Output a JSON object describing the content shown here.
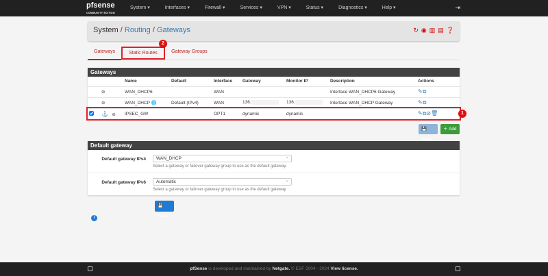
{
  "nav": {
    "logo": "pfsense",
    "logo_sub": "COMMUNITY EDITION",
    "items": [
      "System ▾",
      "Interfaces ▾",
      "Firewall ▾",
      "Services ▾",
      "VPN ▾",
      "Status ▾",
      "Diagnostics ▾",
      "Help ▾"
    ]
  },
  "breadcrumb": {
    "root": "System",
    "sep": "/",
    "routing": "Routing",
    "page": "Gateways"
  },
  "tabs": [
    "Gateways",
    "Static Routes",
    "Gateway Groups"
  ],
  "badges": {
    "one": "1",
    "two": "2"
  },
  "gateways": {
    "title": "Gateways",
    "headers": [
      "Name",
      "Default",
      "Interface",
      "Gateway",
      "Monitor IP",
      "Description",
      "Actions"
    ],
    "rows": [
      {
        "name": "WAN_DHCP6",
        "default": "",
        "interface": "WAN",
        "gateway": "",
        "monitor": "",
        "description": "Interface WAN_DHCP6 Gateway"
      },
      {
        "name": "WAN_DHCP",
        "default": "Default (IPv4)",
        "interface": "WAN",
        "gateway": "136.",
        "monitor": "136.",
        "description": "Interface WAN_DHCP Gateway"
      },
      {
        "name": "IPSEC_GW",
        "default": "",
        "interface": "OPT1",
        "gateway": "dynamic",
        "monitor": "dynamic",
        "description": ""
      }
    ]
  },
  "buttons": {
    "save": "Save",
    "add": "Add"
  },
  "default_gateway": {
    "title": "Default gateway",
    "ipv4_label": "Default gateway IPv4",
    "ipv4_value": "WAN_DHCP",
    "ipv6_label": "Default gateway IPv6",
    "ipv6_value": "Automatic",
    "help": "Select a gateway or failover gateway group to use as the default gateway.",
    "save": "Save"
  },
  "footer": {
    "brand": "pfSense",
    "text1": " is developed and maintained by ",
    "netgate": "Netgate.",
    "text2": " © ESF 2004 - 2024 ",
    "license": "View license."
  }
}
